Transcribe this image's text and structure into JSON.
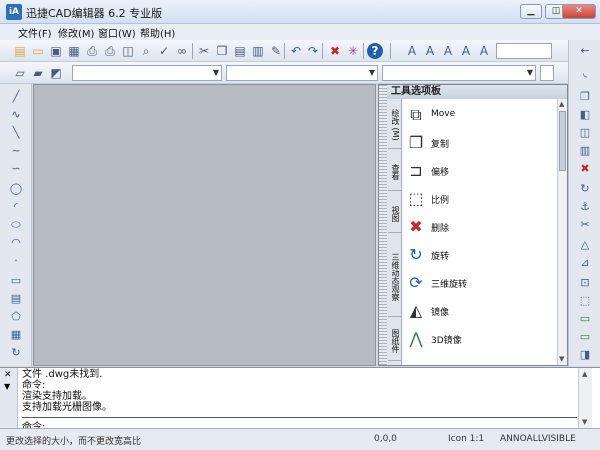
{
  "window": {
    "title": "迅捷CAD编辑器 6.2 专业版",
    "icon_text": "iA",
    "controls": [
      "minimize",
      "restore",
      "close"
    ]
  },
  "menu": {
    "items": [
      {
        "label": "文件(F)"
      },
      {
        "label": "修改(M)"
      },
      {
        "label": "窗口(W)"
      },
      {
        "label": "帮助(H)"
      }
    ]
  },
  "palette": {
    "title": "工具选项板",
    "tabs": [
      "绘改 (M)",
      "查看",
      "视图",
      "三维动态观察",
      "图纸件"
    ],
    "tools": [
      {
        "label": "Move",
        "icon": "move-icon",
        "color": "#333333"
      },
      {
        "label": "复制",
        "icon": "copy-icon",
        "color": "#333333"
      },
      {
        "label": "偏移",
        "icon": "offset-icon",
        "color": "#333333"
      },
      {
        "label": "比例",
        "icon": "scale-icon",
        "color": "#333333"
      },
      {
        "label": "删除",
        "icon": "delete-icon",
        "color": "#c62828"
      },
      {
        "label": "旋转",
        "icon": "rotate-icon",
        "color": "#1e5fa8"
      },
      {
        "label": "三维旋转",
        "icon": "rotate-3d-icon",
        "color": "#1e5fa8"
      },
      {
        "label": "镜像",
        "icon": "mirror-icon",
        "color": "#333333"
      },
      {
        "label": "3D镜像",
        "icon": "mirror-3d-icon",
        "color": "#2e7d32"
      }
    ]
  },
  "command": {
    "lines": [
      "文件           .dwg未找到.",
      "命令:",
      "渲染支持加载。",
      "支持加载光栅图像。"
    ],
    "prompt": "命令:"
  },
  "status": {
    "hint": "更改选择的大小，而不更改宽高比",
    "coords": "0,0,0",
    "annotation": "ANNOALLVISIBLE",
    "mode": "Icon 1:1"
  }
}
